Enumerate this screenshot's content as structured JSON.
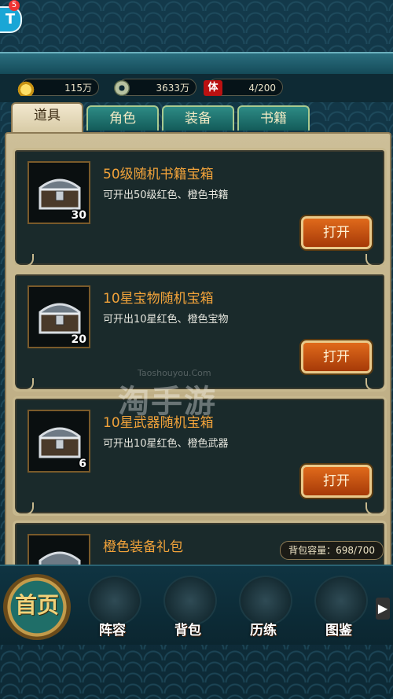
{
  "badge": {
    "logo_letter": "T",
    "count": "5"
  },
  "resources": {
    "gold": "115万",
    "silver": "3633万",
    "stamina_icon": "体",
    "stamina": "4/200"
  },
  "tabs": [
    {
      "label": "道具",
      "active": true
    },
    {
      "label": "角色",
      "active": false
    },
    {
      "label": "装备",
      "active": false
    },
    {
      "label": "书籍",
      "active": false
    }
  ],
  "items": [
    {
      "name": "50级随机书籍宝箱",
      "desc": "可开出50级红色、橙色书籍",
      "qty": "30",
      "button": "打开"
    },
    {
      "name": "10星宝物随机宝箱",
      "desc": "可开出10星红色、橙色宝物",
      "qty": "20",
      "button": "打开"
    },
    {
      "name": "10星武器随机宝箱",
      "desc": "可开出10星红色、橙色武器",
      "qty": "6",
      "button": "打开"
    },
    {
      "name": "橙色装备礼包"
    }
  ],
  "bag_capacity": "背包容量：698/700",
  "nav": {
    "home": "首页",
    "lineup": "阵容",
    "bag": "背包",
    "training": "历练",
    "atlas": "图鉴",
    "more_arrow": "▶"
  },
  "watermark": {
    "main": "淘手游",
    "url": "Taoshouyou.Com"
  }
}
